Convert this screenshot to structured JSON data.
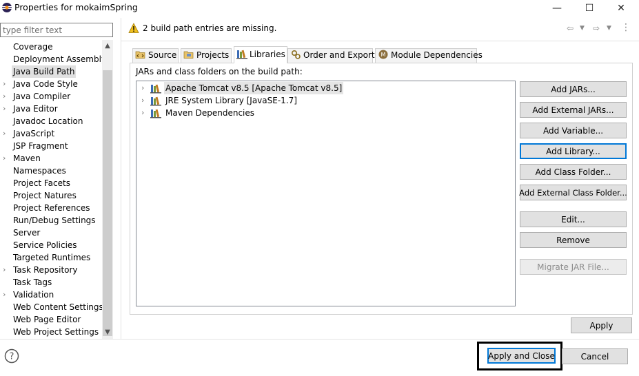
{
  "window": {
    "title": "Properties for mokaimSpring",
    "minimize_glyph": "—",
    "maximize_glyph": "☐",
    "close_glyph": "✕"
  },
  "filter": {
    "placeholder": "type filter text"
  },
  "sidebar": {
    "items": [
      {
        "label": "Coverage",
        "expandable": false,
        "selected": false
      },
      {
        "label": "Deployment Assembly",
        "expandable": false,
        "selected": false
      },
      {
        "label": "Java Build Path",
        "expandable": false,
        "selected": true
      },
      {
        "label": "Java Code Style",
        "expandable": true,
        "selected": false
      },
      {
        "label": "Java Compiler",
        "expandable": true,
        "selected": false
      },
      {
        "label": "Java Editor",
        "expandable": true,
        "selected": false
      },
      {
        "label": "Javadoc Location",
        "expandable": false,
        "selected": false
      },
      {
        "label": "JavaScript",
        "expandable": true,
        "selected": false
      },
      {
        "label": "JSP Fragment",
        "expandable": false,
        "selected": false
      },
      {
        "label": "Maven",
        "expandable": true,
        "selected": false
      },
      {
        "label": "Namespaces",
        "expandable": false,
        "selected": false
      },
      {
        "label": "Project Facets",
        "expandable": false,
        "selected": false
      },
      {
        "label": "Project Natures",
        "expandable": false,
        "selected": false
      },
      {
        "label": "Project References",
        "expandable": false,
        "selected": false
      },
      {
        "label": "Run/Debug Settings",
        "expandable": false,
        "selected": false
      },
      {
        "label": "Server",
        "expandable": false,
        "selected": false
      },
      {
        "label": "Service Policies",
        "expandable": false,
        "selected": false
      },
      {
        "label": "Targeted Runtimes",
        "expandable": false,
        "selected": false
      },
      {
        "label": "Task Repository",
        "expandable": true,
        "selected": false
      },
      {
        "label": "Task Tags",
        "expandable": false,
        "selected": false
      },
      {
        "label": "Validation",
        "expandable": true,
        "selected": false
      },
      {
        "label": "Web Content Settings",
        "expandable": false,
        "selected": false
      },
      {
        "label": "Web Page Editor",
        "expandable": false,
        "selected": false
      },
      {
        "label": "Web Project Settings",
        "expandable": false,
        "selected": false
      }
    ]
  },
  "message": {
    "text": "2 build path entries are missing.",
    "icon": "warning-icon"
  },
  "tabs": [
    {
      "label": "Source",
      "icon": "source-folder-icon",
      "active": false
    },
    {
      "label": "Projects",
      "icon": "project-icon",
      "active": false
    },
    {
      "label": "Libraries",
      "icon": "library-icon",
      "active": true
    },
    {
      "label": "Order and Export",
      "icon": "order-export-icon",
      "active": false
    },
    {
      "label": "Module Dependencies",
      "icon": "module-icon",
      "active": false
    }
  ],
  "libraries": {
    "label": "JARs and class folders on the build path:",
    "entries": [
      {
        "label": "Apache Tomcat v8.5 [Apache Tomcat v8.5]",
        "selected": true
      },
      {
        "label": "JRE System Library [JavaSE-1.7]",
        "selected": false
      },
      {
        "label": "Maven Dependencies",
        "selected": false
      }
    ]
  },
  "buttons": {
    "add_jars": "Add JARs...",
    "add_external_jars": "Add External JARs...",
    "add_variable": "Add Variable...",
    "add_library": "Add Library...",
    "add_class_folder": "Add Class Folder...",
    "add_external_class_folder": "Add External Class Folder...",
    "edit": "Edit...",
    "remove": "Remove",
    "migrate_jar": "Migrate JAR File...",
    "apply": "Apply",
    "apply_and_close": "Apply and Close",
    "cancel": "Cancel"
  },
  "colors": {
    "focus": "#0078d7",
    "warning": "#f0c020",
    "selection": "#e0e0e0"
  }
}
